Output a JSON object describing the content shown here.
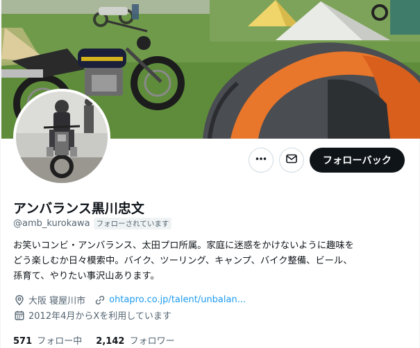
{
  "profile": {
    "display_name": "アンバランス黒川忠文",
    "handle": "@amb_kurokawa",
    "follows_you_badge": "フォローされています",
    "bio_lines": [
      "お笑いコンビ・アンバランス、太田プロ所属。家庭に迷惑をかけないように趣味を",
      "どう楽しむか日々模索中。バイク、ツーリング、キャンプ、バイク整備、ビール、",
      "孫育て、やりたい事沢山あります。"
    ],
    "location": "大阪 寝屋川市",
    "website": "ohtapro.co.jp/talent/unbalan...",
    "joined": "2012年4月からXを利用しています"
  },
  "actions": {
    "more_icon": "more-horizontal-icon",
    "message_icon": "envelope-icon",
    "follow_back_label": "フォローバック"
  },
  "stats": {
    "following_count": "571",
    "following_label": "フォロー中",
    "followers_count": "2,142",
    "followers_label": "フォロワー"
  },
  "icons": {
    "location": "location-pin-icon",
    "website": "link-icon",
    "joined": "calendar-icon"
  },
  "colors": {
    "text_primary": "#0f1419",
    "text_secondary": "#536471",
    "link": "#1d9bf0",
    "button_dark": "#0f1419",
    "border": "#cfd9de"
  }
}
